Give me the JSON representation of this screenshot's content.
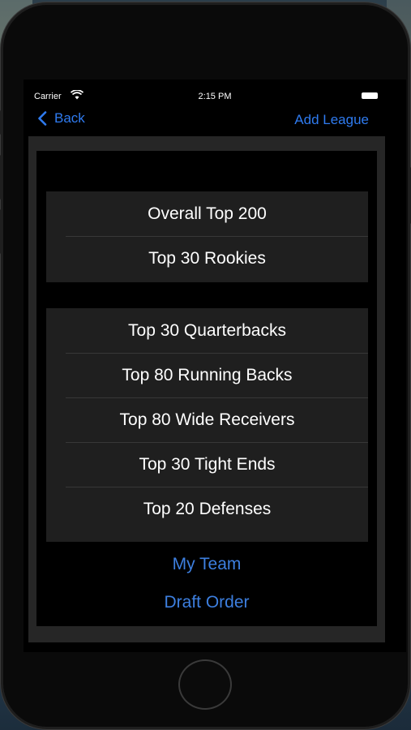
{
  "status_bar": {
    "carrier": "Carrier",
    "time": "2:15 PM",
    "icons": [
      "wifi-icon",
      "battery-icon"
    ]
  },
  "nav": {
    "back_label": "Back",
    "add_label": "Add League",
    "icons": [
      "chevron-left-icon"
    ]
  },
  "groups": [
    {
      "rows": [
        "Overall Top 200",
        "Top 30 Rookies"
      ]
    },
    {
      "rows": [
        "Top 30 Quarterbacks",
        "Top 80 Running Backs",
        "Top 80 Wide Receivers",
        "Top 30 Tight Ends",
        "Top 20 Defenses"
      ]
    }
  ],
  "links": {
    "my_team": "My Team",
    "draft_order": "Draft Order"
  },
  "colors": {
    "accent": "#2f7bf0",
    "link": "#3d7fdf",
    "cell_background": "#1f1f1f",
    "frame": "#262626",
    "text": "#ffffff"
  }
}
